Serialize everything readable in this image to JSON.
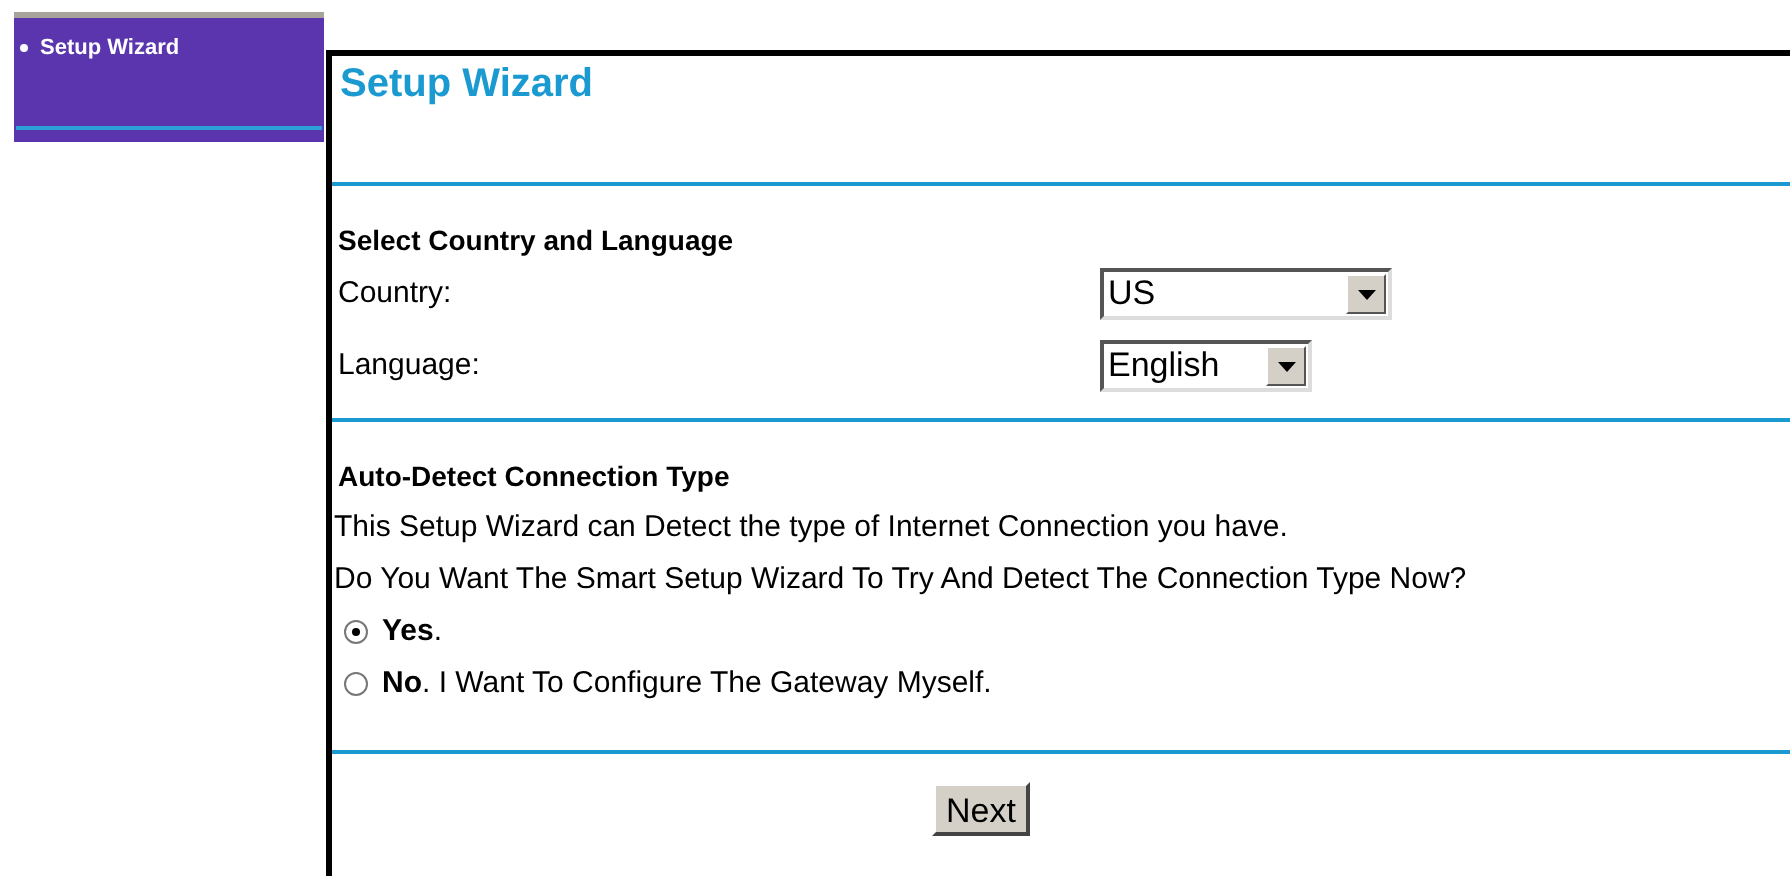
{
  "sidebar": {
    "items": [
      {
        "label": "Setup Wizard",
        "selected": true
      }
    ]
  },
  "title": "Setup Wizard",
  "country_section": {
    "heading": "Select Country and Language",
    "fields": [
      {
        "label": "Country:",
        "value": "US",
        "kind": "wide"
      },
      {
        "label": "Language:",
        "value": "English",
        "kind": "narrow"
      }
    ]
  },
  "detect_section": {
    "heading": "Auto-Detect Connection Type",
    "lines": [
      "This Setup Wizard can Detect the type of Internet Connection you have.",
      "Do You Want The Smart Setup Wizard To Try And Detect The Connection Type Now?"
    ],
    "options": [
      {
        "label": "**Yes**.",
        "selected": true
      },
      {
        "label": "**No**. I Want To Configure The Gateway Myself.",
        "selected": false
      }
    ]
  },
  "next_button": "Next"
}
